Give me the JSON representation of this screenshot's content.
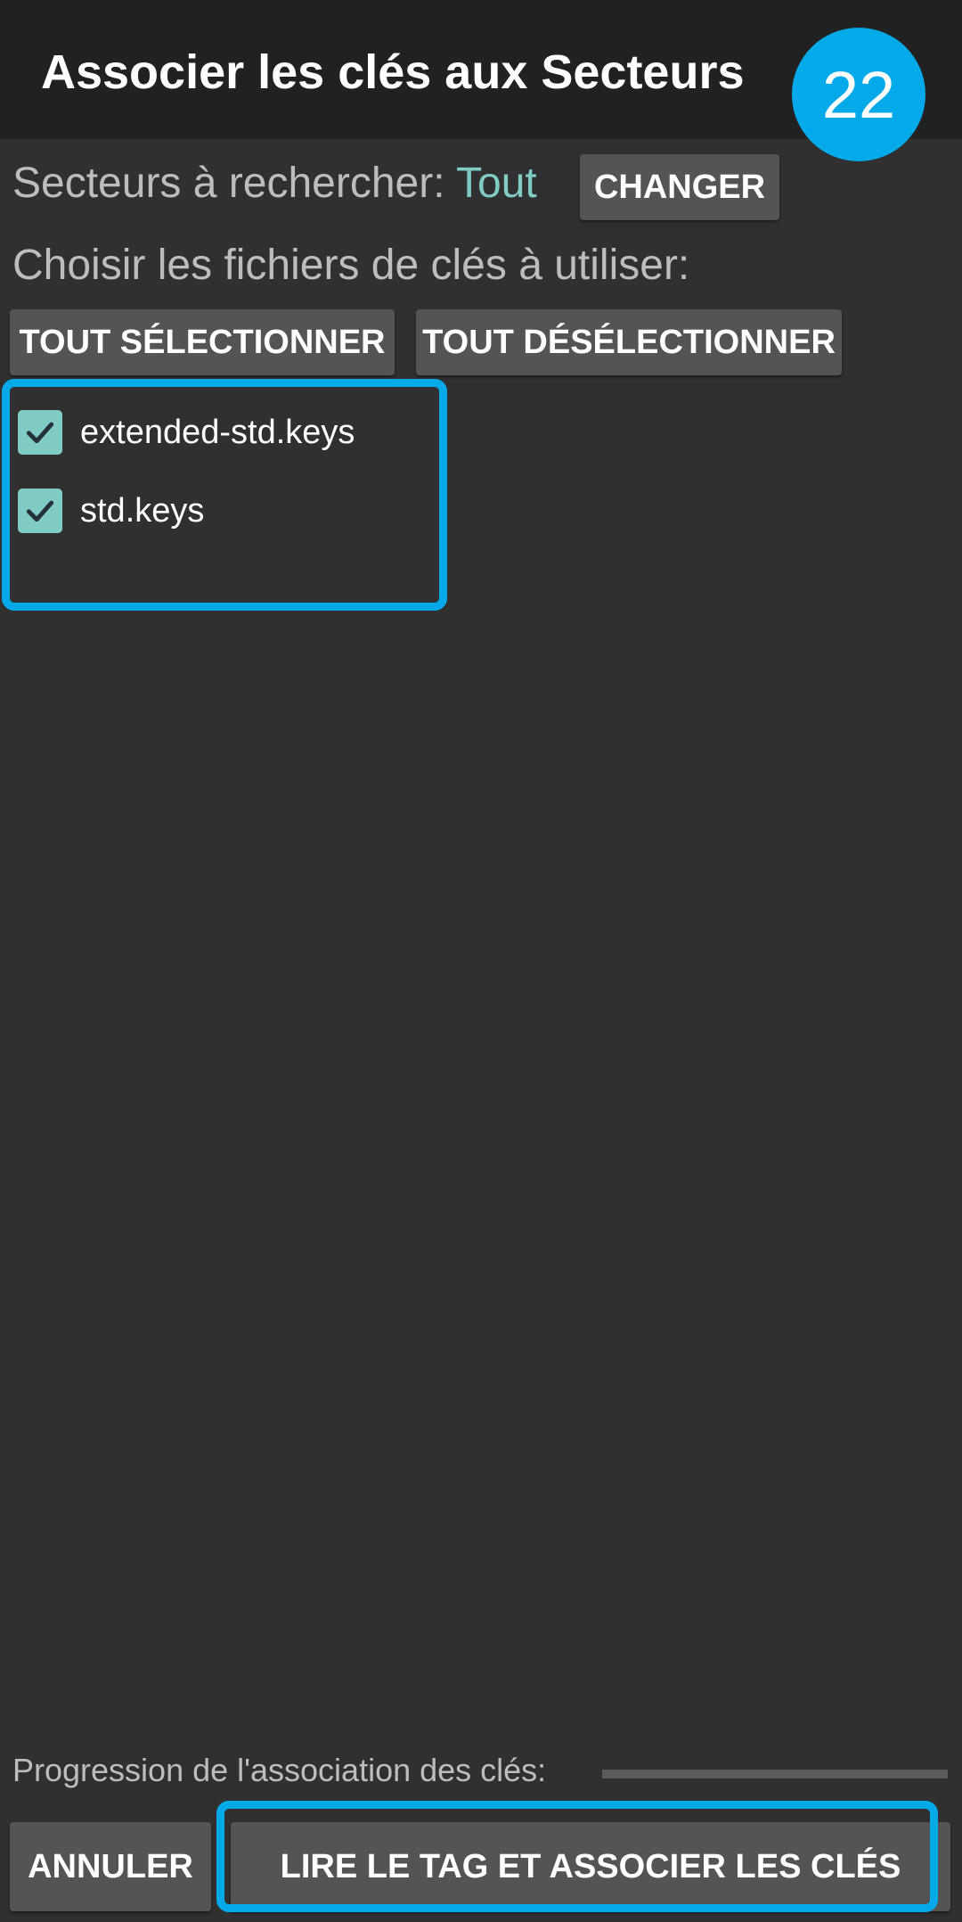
{
  "appbar": {
    "title": "Associer les clés aux Secteurs",
    "step_badge": "22"
  },
  "sectors": {
    "label": "Secteurs à rechercher:",
    "value": "Tout",
    "change_button": "CHANGER"
  },
  "key_files": {
    "label": "Choisir les fichiers de clés à utiliser:",
    "select_all_button": "TOUT SÉLECTIONNER",
    "deselect_all_button": "TOUT DÉSÉLECTIONNER",
    "items": [
      {
        "label": "extended-std.keys",
        "checked": true
      },
      {
        "label": "std.keys",
        "checked": true
      }
    ]
  },
  "progress": {
    "label": "Progression de l'association des clés:",
    "value": 0
  },
  "footer": {
    "cancel_button": "ANNULER",
    "read_button": "LIRE LE TAG ET ASSOCIER LES CLÉS"
  },
  "colors": {
    "accent": "#80cbc4",
    "highlight": "#03a9e8",
    "background": "#303030",
    "appbar": "#212121"
  }
}
